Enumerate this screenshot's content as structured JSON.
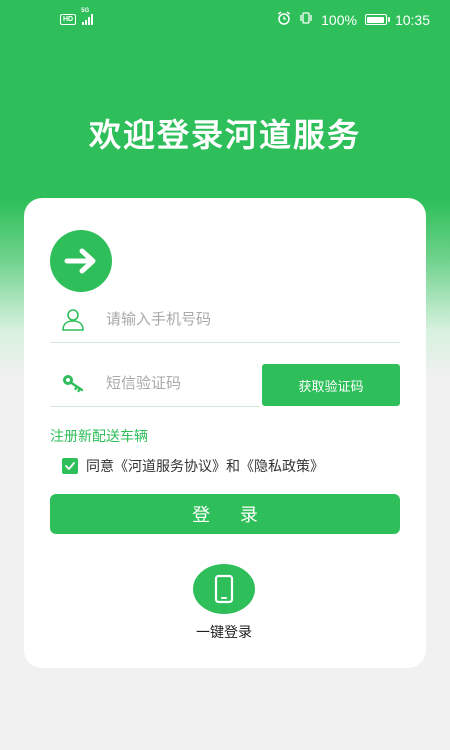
{
  "status_bar": {
    "hd": "HD",
    "network": "5G",
    "battery_text": "100%",
    "battery_level": 1.0,
    "time": "10:35"
  },
  "header": {
    "title": "欢迎登录河道服务"
  },
  "login_form": {
    "phone_placeholder": "请输入手机号码",
    "code_placeholder": "短信验证码",
    "get_code_label": "获取验证码",
    "register_link": "注册新配送车辆",
    "agreement_text": "同意《河道服务协议》和《隐私政策》",
    "agreement_checked": true,
    "login_label": "登 录"
  },
  "quick_login": {
    "label": "一键登录"
  },
  "colors": {
    "brand_green": "#2ebf5a",
    "background": "#f1f1f1"
  },
  "icons": {
    "header": "arrow-right-icon",
    "phone_field": "user-icon",
    "code_field": "key-icon",
    "checkbox": "check-icon",
    "quick_login": "mobile-phone-icon"
  }
}
